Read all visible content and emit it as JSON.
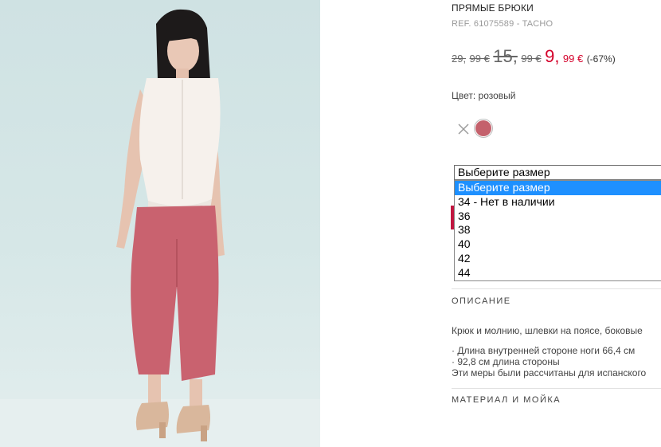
{
  "product": {
    "title": "ПРЯМЫЕ БРЮКИ",
    "ref": "REF. 61075589 - TACHO"
  },
  "price": {
    "old1_int": "29,",
    "old1_dec": "99 €",
    "old2_int": "15,",
    "old2_dec": "99 €",
    "new_int": "9,",
    "new_dec": "99 €",
    "discount": "(-67%)"
  },
  "color": {
    "label": "Цвет: розовый",
    "swatch_hex": "#c4616c"
  },
  "size_select": {
    "current": "Выберите размер",
    "options": [
      "Выберите размер",
      "34 - Нет в наличии",
      "36",
      "38",
      "40",
      "42",
      "44"
    ]
  },
  "description": {
    "heading": "ОПИСАНИЕ",
    "text": "Крюк и молнию, шлевки на поясе, боковые",
    "bullets": [
      "· Длина внутренней стороне ноги 66,4 см",
      "· 92,8 см длина стороны"
    ],
    "note": "Эти меры были рассчитаны для испанского"
  },
  "materials": {
    "heading": "МАТЕРИАЛ И МОЙКА"
  }
}
